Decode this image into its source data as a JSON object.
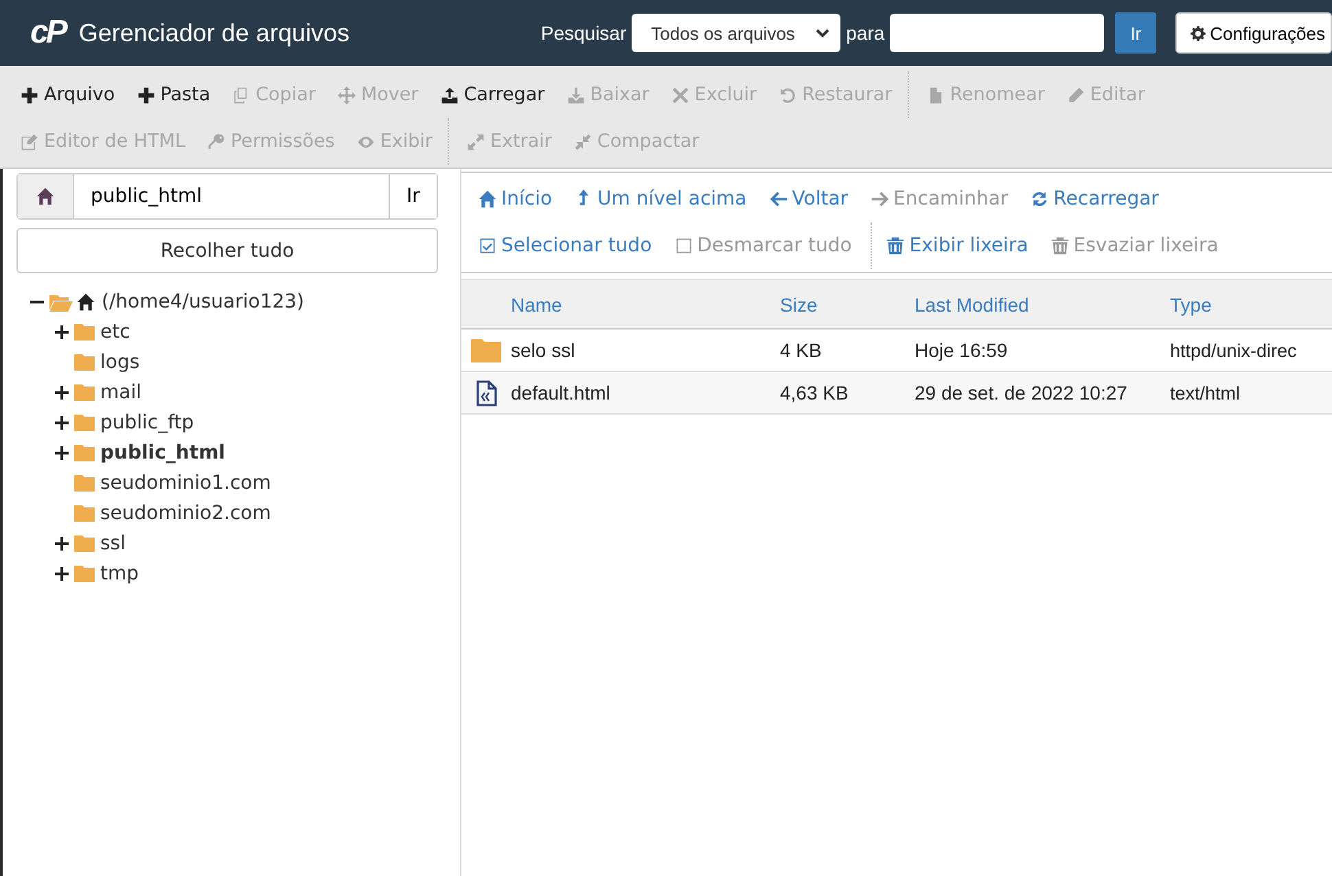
{
  "header": {
    "logo": "cP",
    "title": "Gerenciador de arquivos",
    "search_label": "Pesquisar",
    "search_scope": "Todos os arquivos",
    "for_label": "para",
    "go": "Ir",
    "settings": "Configurações"
  },
  "toolbar": {
    "rows": [
      {
        "groups": [
          {
            "buttons": [
              {
                "label": "Arquivo",
                "disabled": false
              },
              {
                "label": "Pasta",
                "disabled": false
              },
              {
                "label": "Copiar",
                "disabled": true
              },
              {
                "label": "Mover",
                "disabled": true
              },
              {
                "label": "Carregar",
                "disabled": false
              },
              {
                "label": "Baixar",
                "disabled": true
              },
              {
                "label": "Excluir",
                "disabled": true
              },
              {
                "label": "Restaurar",
                "disabled": true
              }
            ]
          },
          {
            "buttons": [
              {
                "label": "Renomear",
                "disabled": true
              },
              {
                "label": "Editar",
                "disabled": true
              }
            ]
          }
        ]
      },
      {
        "groups": [
          {
            "buttons": [
              {
                "label": "Editor de HTML",
                "disabled": true
              },
              {
                "label": "Permissões",
                "disabled": true
              },
              {
                "label": "Exibir",
                "disabled": true
              }
            ]
          },
          {
            "buttons": [
              {
                "label": "Extrair",
                "disabled": true
              },
              {
                "label": "Compactar",
                "disabled": true
              }
            ]
          }
        ]
      }
    ]
  },
  "sidebar": {
    "path": "public_html",
    "go": "Ir",
    "collapse": "Recolher tudo",
    "tree": [
      {
        "label": "(/home4/usuario123)",
        "expanded": true,
        "selected": false,
        "children": [
          {
            "label": "etc",
            "expandable": true,
            "selected": false
          },
          {
            "label": "logs",
            "expandable": false,
            "selected": false
          },
          {
            "label": "mail",
            "expandable": true,
            "selected": false
          },
          {
            "label": "public_ftp",
            "expandable": true,
            "selected": false
          },
          {
            "label": "public_html",
            "expandable": true,
            "selected": true
          },
          {
            "label": "seudominio1.com",
            "expandable": false,
            "selected": false
          },
          {
            "label": "seudominio2.com",
            "expandable": false,
            "selected": false
          },
          {
            "label": "ssl",
            "expandable": true,
            "selected": false
          },
          {
            "label": "tmp",
            "expandable": true,
            "selected": false
          }
        ]
      }
    ]
  },
  "nav": {
    "rows": [
      {
        "groups": [
          {
            "buttons": [
              {
                "label": "Início",
                "disabled": false
              },
              {
                "label": "Um nível acima",
                "disabled": false
              },
              {
                "label": "Voltar",
                "disabled": false
              },
              {
                "label": "Encaminhar",
                "disabled": true
              },
              {
                "label": "Recarregar",
                "disabled": false
              }
            ]
          }
        ]
      },
      {
        "groups": [
          {
            "buttons": [
              {
                "label": "Selecionar tudo",
                "disabled": false
              },
              {
                "label": "Desmarcar tudo",
                "disabled": true
              }
            ]
          },
          {
            "buttons": [
              {
                "label": "Exibir lixeira",
                "disabled": false
              },
              {
                "label": "Esvaziar lixeira",
                "disabled": true
              }
            ]
          }
        ]
      }
    ]
  },
  "table": {
    "columns": [
      "Name",
      "Size",
      "Last Modified",
      "Type"
    ],
    "rows": [
      {
        "kind": "folder",
        "cells": [
          "selo ssl",
          "4 KB",
          "Hoje 16:59",
          "httpd/unix-direc"
        ]
      },
      {
        "kind": "file",
        "cells": [
          "default.html",
          "4,63 KB",
          "29 de set. de 2022 10:27",
          "text/html"
        ]
      }
    ]
  }
}
